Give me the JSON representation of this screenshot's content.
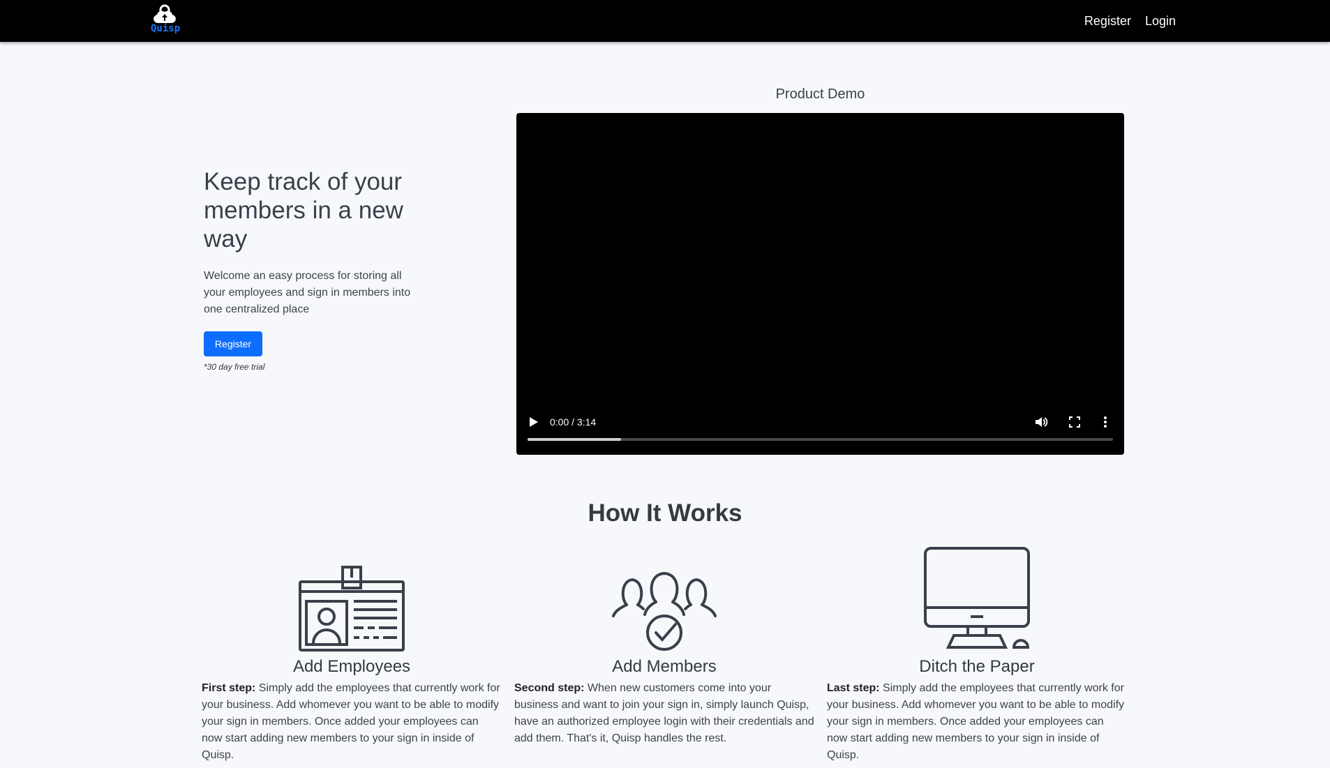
{
  "nav": {
    "brand": "Quisp",
    "register": "Register",
    "login": "Login"
  },
  "hero": {
    "title": "Keep track of your members in a new way",
    "description": "Welcome an easy process for storing all your employees and sign in members into one centralized place",
    "register_button": "Register",
    "trial_note": "*30 day free trial"
  },
  "demo": {
    "label": "Product Demo",
    "time": "0:00 / 3:14",
    "buffered_fraction": 0.16
  },
  "how": {
    "title": "How It Works",
    "features": [
      {
        "title": "Add Employees",
        "step": "First step:",
        "text": " Simply add the employees that currently work for your business. Add whomever you want to be able to modify your sign in members. Once added your employees can now start adding new members to your sign in inside of Quisp."
      },
      {
        "title": "Add Members",
        "step": "Second step:",
        "text": " When new customers come into your business and want to join your sign in, simply launch Quisp, have an authorized employee login with their credentials and add them. That's it, Quisp handles the rest."
      },
      {
        "title": "Ditch the Paper",
        "step": "Last step:",
        "text": " Simply add the employees that currently work for your business. Add whomever you want to be able to modify your sign in members. Once added your employees can now start adding new members to your sign in inside of Quisp."
      }
    ]
  },
  "colors": {
    "accent": "#0d6efd",
    "brand": "#1976ff",
    "navbar": "#000000",
    "background": "#f7f8fb"
  },
  "icons": [
    "lock-cloud-logo-icon",
    "id-badge-icon",
    "members-check-icon",
    "desktop-monitor-icon",
    "play-icon",
    "volume-icon",
    "fullscreen-icon",
    "more-vertical-icon"
  ]
}
